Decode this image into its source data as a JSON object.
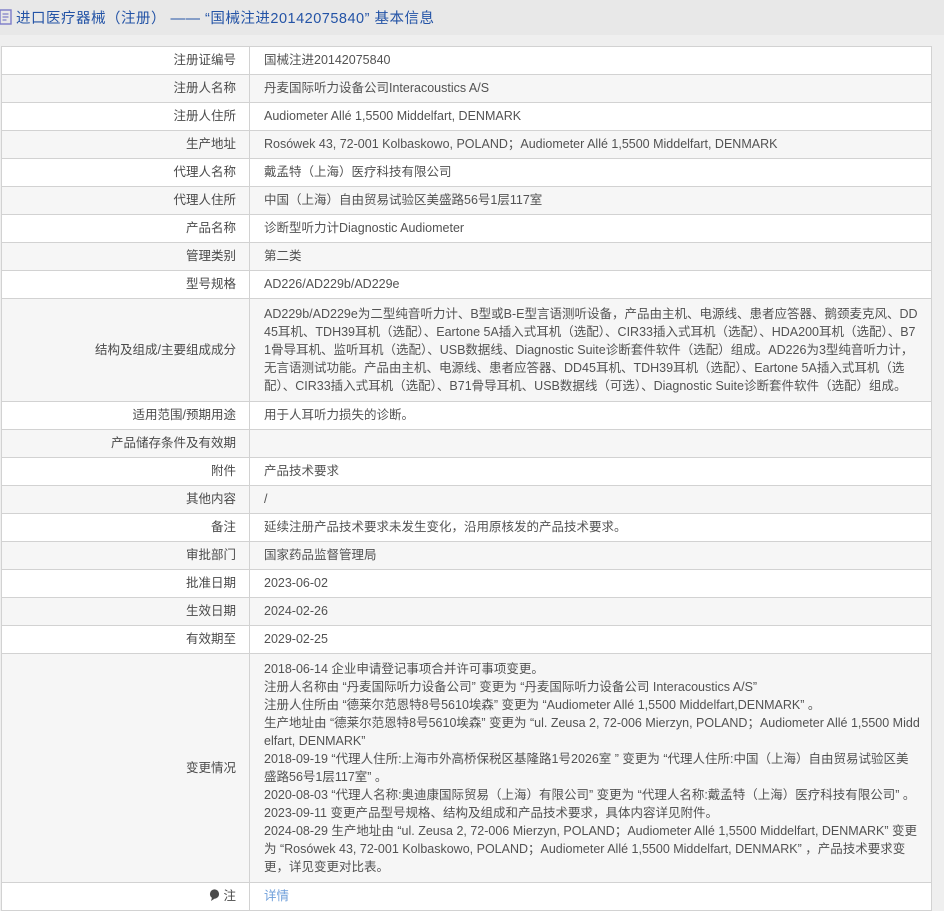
{
  "header": {
    "title": "进口医疗器械（注册） —— “国械注进20142075840” 基本信息",
    "icon": "document-icon"
  },
  "colors": {
    "title_blue": "#2353a6",
    "link_blue": "#6d9eda",
    "row_stripe": "#f6f6f6",
    "border": "#d2d2d2",
    "header_bg": "#e8e8e8"
  },
  "table": {
    "rows": [
      {
        "label": "注册证编号",
        "lines": [
          "国械注进20142075840"
        ]
      },
      {
        "label": "注册人名称",
        "lines": [
          "丹麦国际听力设备公司Interacoustics A/S"
        ]
      },
      {
        "label": "注册人住所",
        "lines": [
          "Audiometer Allé 1,5500 Middelfart, DENMARK"
        ]
      },
      {
        "label": "生产地址",
        "lines": [
          "Rosówek 43, 72-001 Kolbaskowo, POLAND；Audiometer Allé 1,5500 Middelfart, DENMARK"
        ]
      },
      {
        "label": "代理人名称",
        "lines": [
          "戴孟特（上海）医疗科技有限公司"
        ]
      },
      {
        "label": "代理人住所",
        "lines": [
          "中国（上海）自由贸易试验区美盛路56号1层117室"
        ]
      },
      {
        "label": "产品名称",
        "lines": [
          "诊断型听力计Diagnostic Audiometer"
        ]
      },
      {
        "label": "管理类别",
        "lines": [
          "第二类"
        ]
      },
      {
        "label": "型号规格",
        "lines": [
          "AD226/AD229b/AD229e"
        ]
      },
      {
        "label": "结构及组成/主要组成成分",
        "tall": true,
        "lines": [
          "AD229b/AD229e为二型纯音听力计、B型或B-E型言语测听设备，产品由主机、电源线、患者应答器、鹅颈麦克风、DD45耳机、TDH39耳机（选配）、Eartone 5A插入式耳机（选配）、CIR33插入式耳机（选配）、HDA200耳机（选配）、B71骨导耳机、监听耳机（选配）、USB数据线、Diagnostic Suite诊断套件软件（选配）组成。AD226为3型纯音听力计，无言语测试功能。产品由主机、电源线、患者应答器、DD45耳机、TDH39耳机（选配）、Eartone 5A插入式耳机（选配）、CIR33插入式耳机（选配）、B71骨导耳机、USB数据线（可选）、Diagnostic Suite诊断套件软件（选配）组成。"
        ]
      },
      {
        "label": "适用范围/预期用途",
        "lines": [
          "用于人耳听力损失的诊断。"
        ]
      },
      {
        "label": "产品储存条件及有效期",
        "lines": [
          ""
        ]
      },
      {
        "label": "附件",
        "lines": [
          "产品技术要求"
        ]
      },
      {
        "label": "其他内容",
        "lines": [
          "/"
        ]
      },
      {
        "label": "备注",
        "lines": [
          "延续注册产品技术要求未发生变化，沿用原核发的产品技术要求。"
        ]
      },
      {
        "label": "审批部门",
        "lines": [
          "国家药品监督管理局"
        ]
      },
      {
        "label": "批准日期",
        "lines": [
          "2023-06-02"
        ]
      },
      {
        "label": "生效日期",
        "lines": [
          "2024-02-26"
        ]
      },
      {
        "label": "有效期至",
        "lines": [
          "2029-02-25"
        ]
      },
      {
        "label": "变更情况",
        "tall": true,
        "lines": [
          "2018-06-14 企业申请登记事项合并许可事项变更。",
          "注册人名称由 “丹麦国际听力设备公司” 变更为 “丹麦国际听力设备公司 Interacoustics A/S”",
          "注册人住所由  “德莱尔范恩特8号5610埃森” 变更为 “Audiometer Allé 1,5500 Middelfart,DENMARK” 。",
          "生产地址由 “德莱尔范恩特8号5610埃森” 变更为 “ul. Zeusa 2, 72-006 Mierzyn, POLAND；Audiometer Allé 1,5500 Middelfart, DENMARK”",
          "2018-09-19 “代理人住所:上海市外高桥保税区基隆路1号2026室 ” 变更为 “代理人住所:中国（上海）自由贸易试验区美盛路56号1层117室” 。",
          "2020-08-03 “代理人名称:奥迪康国际贸易（上海）有限公司” 变更为 “代理人名称:戴孟特（上海）医疗科技有限公司” 。",
          "2023-09-11 变更产品型号规格、结构及组成和产品技术要求，具体内容详见附件。",
          "2024-08-29 生产地址由 “ul. Zeusa 2, 72-006 Mierzyn, POLAND；Audiometer Allé 1,5500 Middelfart, DENMARK” 变更为 “Rosówek 43, 72-001 Kolbaskowo, POLAND；Audiometer Allé 1,5500 Middelfart, DENMARK” ，产品技术要求变更，详见变更对比表。"
        ]
      },
      {
        "label": "注",
        "icon": "note-icon",
        "link": "详情"
      }
    ]
  }
}
